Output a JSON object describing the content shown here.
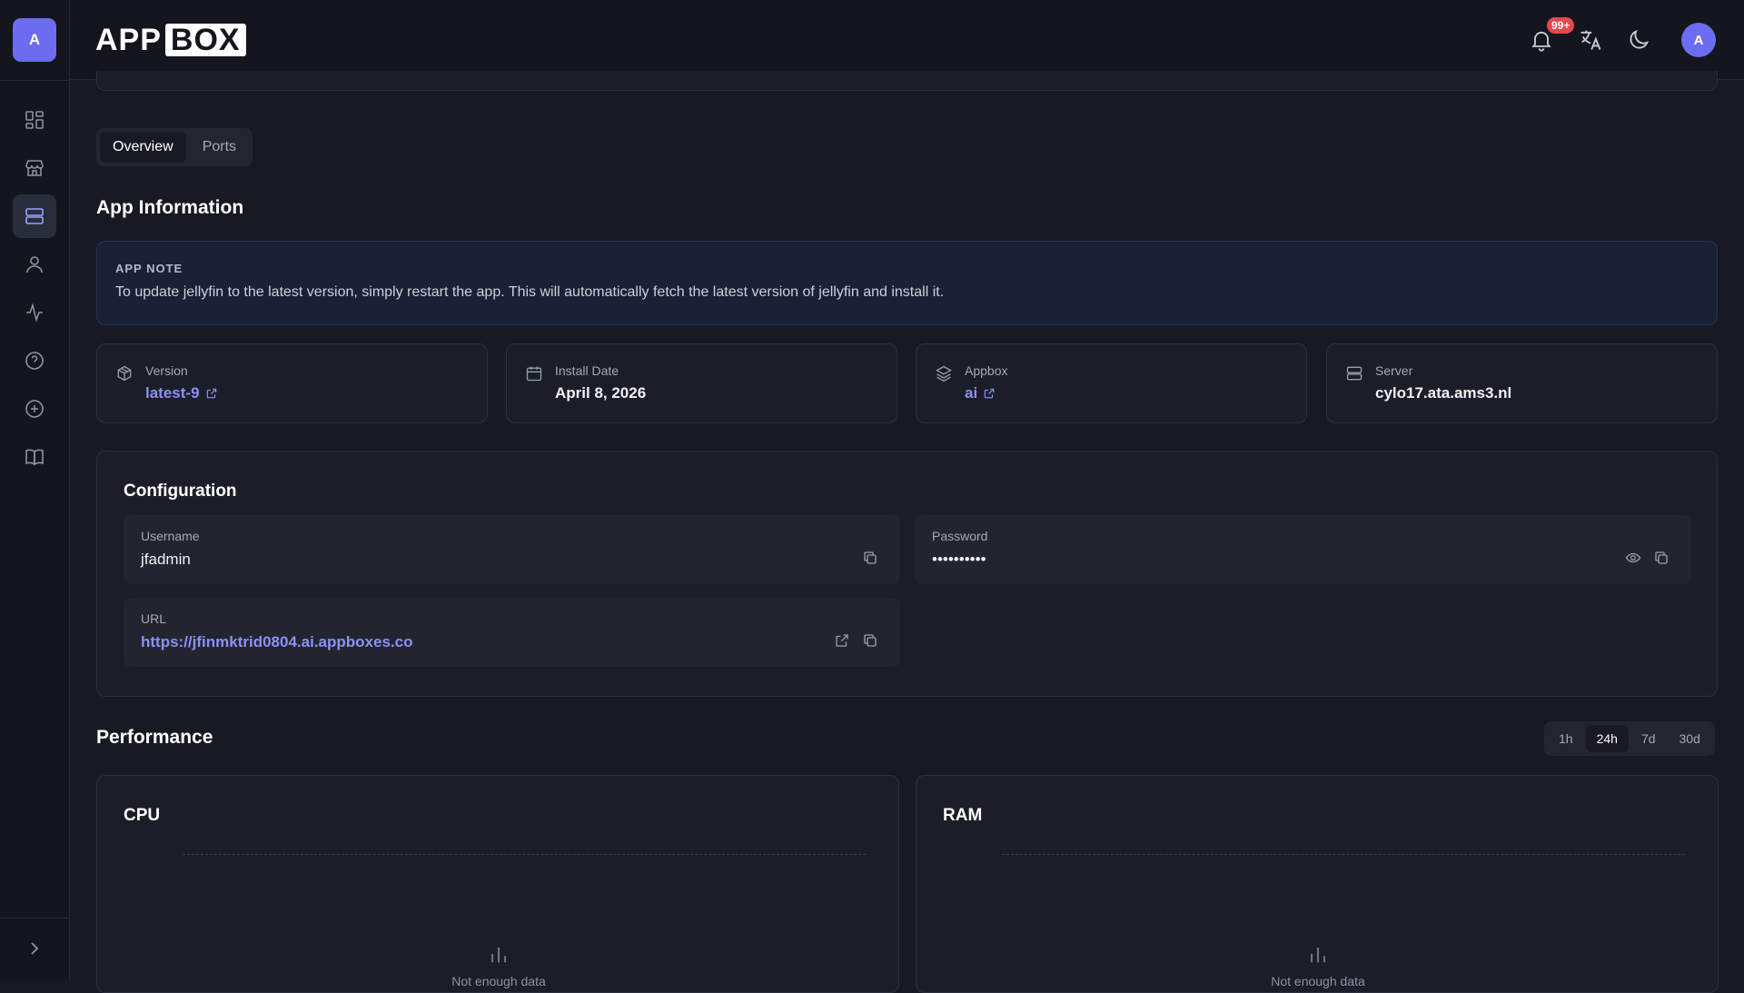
{
  "sidebar": {
    "avatar_letter": "A",
    "items": [
      {
        "name": "dashboard",
        "icon": "grid-icon"
      },
      {
        "name": "store",
        "icon": "store-icon"
      },
      {
        "name": "servers",
        "icon": "server-icon",
        "active": true
      },
      {
        "name": "users",
        "icon": "user-icon"
      },
      {
        "name": "activity",
        "icon": "activity-icon"
      },
      {
        "name": "help",
        "icon": "help-circle-icon"
      },
      {
        "name": "add",
        "icon": "plus-circle-icon"
      },
      {
        "name": "docs",
        "icon": "book-icon"
      }
    ]
  },
  "header": {
    "brand_app": "APP",
    "brand_box": "BOX",
    "notification_badge": "99+",
    "user_avatar_letter": "A"
  },
  "tabs": [
    {
      "label": "Overview",
      "active": true
    },
    {
      "label": "Ports",
      "active": false
    }
  ],
  "app_information": {
    "title": "App Information",
    "note_label": "APP NOTE",
    "note_text": "To update jellyfin to the latest version, simply restart the app. This will automatically fetch the latest version of jellyfin and install it.",
    "cards": [
      {
        "label": "Version",
        "value": "latest-9",
        "link": true,
        "icon": "package-icon"
      },
      {
        "label": "Install Date",
        "value": "April 8, 2026",
        "link": false,
        "icon": "calendar-icon"
      },
      {
        "label": "Appbox",
        "value": "ai",
        "link": true,
        "icon": "layers-icon"
      },
      {
        "label": "Server",
        "value": "cylo17.ata.ams3.nl",
        "link": false,
        "icon": "server-icon"
      }
    ]
  },
  "configuration": {
    "title": "Configuration",
    "username_label": "Username",
    "username_value": "jfadmin",
    "password_label": "Password",
    "password_value": "••••••••••",
    "url_label": "URL",
    "url_value": "https://jfinmktrid0804.ai.appboxes.co"
  },
  "performance": {
    "title": "Performance",
    "ranges": [
      {
        "label": "1h",
        "active": false
      },
      {
        "label": "24h",
        "active": true
      },
      {
        "label": "7d",
        "active": false
      },
      {
        "label": "30d",
        "active": false
      }
    ],
    "cpu_title": "CPU",
    "ram_title": "RAM",
    "empty_text": "Not enough data"
  },
  "colors": {
    "accent": "#6c6cf0",
    "link": "#8e8ff7",
    "badge": "#e5484d",
    "background": "#181a23"
  }
}
